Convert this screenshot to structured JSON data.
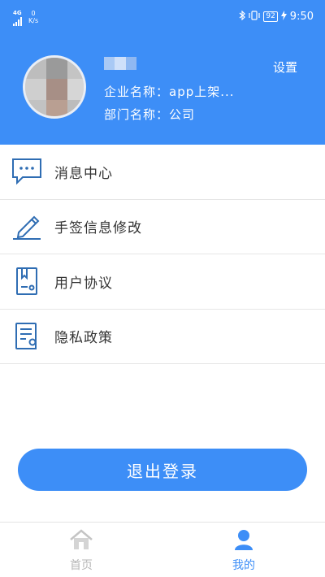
{
  "status_bar": {
    "network": "4G",
    "speed_value": "0",
    "speed_unit": "K/s",
    "battery": "92",
    "time": "9:50"
  },
  "profile": {
    "company_label": "企业名称：app上架...",
    "department_label": "部门名称：公司",
    "settings_label": "设置"
  },
  "menu": {
    "items": [
      {
        "label": "消息中心",
        "icon": "chat-bubble-icon"
      },
      {
        "label": "手签信息修改",
        "icon": "pencil-icon"
      },
      {
        "label": "用户协议",
        "icon": "agreement-document-icon"
      },
      {
        "label": "隐私政策",
        "icon": "privacy-document-icon"
      }
    ]
  },
  "logout_label": "退出登录",
  "tabbar": {
    "tabs": [
      {
        "label": "首页",
        "icon": "home-icon",
        "active": false
      },
      {
        "label": "我的",
        "icon": "person-icon",
        "active": true
      }
    ]
  },
  "colors": {
    "primary": "#3d8ef7",
    "icon_blue": "#2f6db3",
    "inactive_tab": "#b6b6b6"
  }
}
